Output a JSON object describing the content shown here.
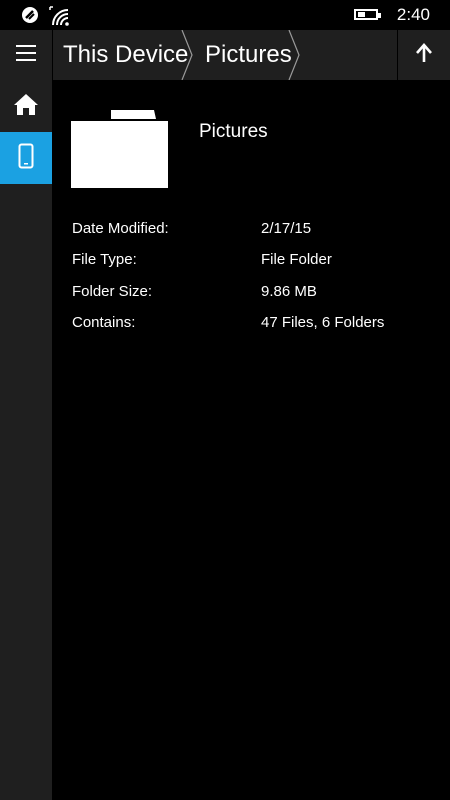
{
  "status_bar": {
    "time": "2:40",
    "icons": [
      "vibrate-icon",
      "wifi-icon",
      "battery-icon"
    ]
  },
  "breadcrumb": {
    "items": [
      "This Device",
      "Pictures"
    ]
  },
  "toolbar": {
    "menu_icon": "hamburger-icon",
    "up_icon": "up-arrow-icon"
  },
  "sidebar": {
    "items": [
      {
        "icon": "home-icon",
        "active": false
      },
      {
        "icon": "phone-device-icon",
        "active": true
      }
    ]
  },
  "folder": {
    "name": "Pictures",
    "icon": "folder-icon",
    "properties": [
      {
        "label": "Date Modified:",
        "value": "2/17/15"
      },
      {
        "label": "File Type:",
        "value": "File Folder"
      },
      {
        "label": "Folder Size:",
        "value": "9.86 MB"
      },
      {
        "label": "Contains:",
        "value": "47 Files, 6 Folders"
      }
    ]
  },
  "colors": {
    "accent": "#1ba1e2",
    "chrome": "#1f1f1f",
    "background": "#000000",
    "text": "#ffffff"
  }
}
